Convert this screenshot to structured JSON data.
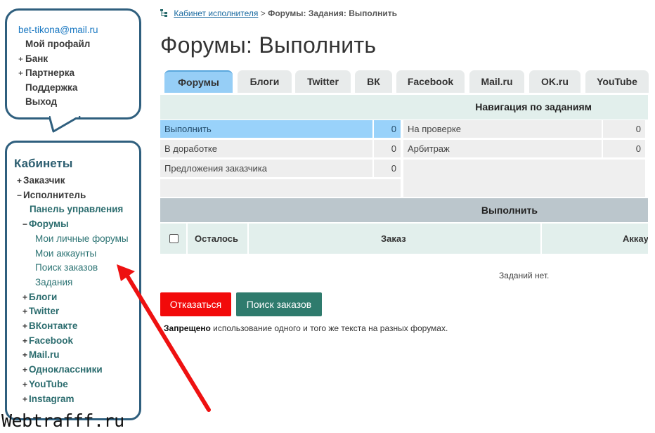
{
  "user_menu": {
    "email": "bet-tikona@mail.ru",
    "items": [
      {
        "label": "Мой профайл",
        "expandable": false
      },
      {
        "label": "Банк",
        "expandable": true
      },
      {
        "label": "Партнерка",
        "expandable": true
      },
      {
        "label": "Поддержка",
        "expandable": false
      },
      {
        "label": "Выход",
        "expandable": false
      }
    ]
  },
  "sidebar": {
    "title": "Кабинеты",
    "customer": "Заказчик",
    "executor": "Исполнитель",
    "control_panel": "Панель управления",
    "forums": "Форумы",
    "forum_children": [
      "Мои личные форумы",
      "Мои аккаунты",
      "Поиск заказов",
      "Задания"
    ],
    "others": [
      "Блоги",
      "Twitter",
      "ВКонтакте",
      "Facebook",
      "Mail.ru",
      "Одноклассники",
      "YouTube",
      "Instagram"
    ]
  },
  "breadcrumb": {
    "link": "Кабинет исполнителя",
    "separator": ">",
    "current": "Форумы: Задания: Выполнить"
  },
  "page_title": "Форумы: Выполнить",
  "tabs": [
    "Форумы",
    "Блоги",
    "Twitter",
    "ВК",
    "Facebook",
    "Mail.ru",
    "OK.ru",
    "YouTube"
  ],
  "active_tab": "Форумы",
  "task_nav": {
    "title": "Навигация по заданиям",
    "rows": [
      {
        "label": "Выполнить",
        "count": "0"
      },
      {
        "label": "В доработке",
        "count": "0"
      },
      {
        "label": "Предложения заказчика",
        "count": "0"
      },
      {
        "label": "На проверке",
        "count": "0"
      },
      {
        "label": "Арбитраж",
        "count": "0"
      }
    ]
  },
  "exec_table": {
    "title": "Выполнить",
    "columns": [
      "Осталось",
      "Заказ",
      "Аккау"
    ],
    "empty": "Заданий нет."
  },
  "buttons": {
    "refuse": "Отказаться",
    "search": "Поиск заказов"
  },
  "notice": {
    "bold": "Запрещено",
    "text": " использование одного и того же текста на разных форумах."
  },
  "watermark": "Webtrafff.ru",
  "colors": {
    "accent": "#2f5f7e",
    "active_tab": "#96cef6",
    "danger": "#f20a0a",
    "success": "#2f7b6d",
    "arrow": "#ee1111"
  }
}
